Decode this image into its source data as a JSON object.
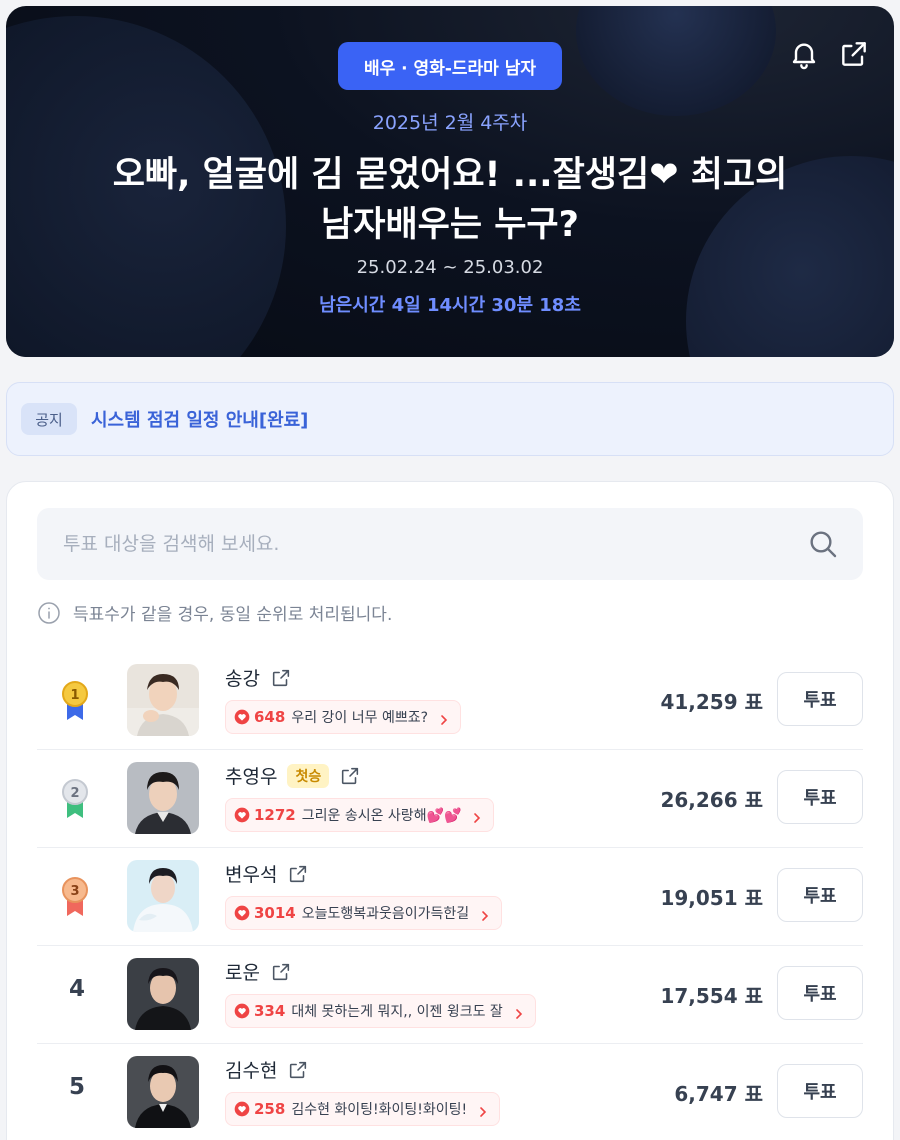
{
  "hero": {
    "category": "배우 · 영화-드라마 남자",
    "week": "2025년 2월 4주차",
    "title_line1": "오빠, 얼굴에 김 묻었어요! ...잘생김",
    "title_heart": "❤",
    "title_line1_end": " 최고의",
    "title_line2": "남자배우는 누구?",
    "period": "25.02.24 ~ 25.03.02",
    "remaining": "남은시간 4일 14시간 30분 18초"
  },
  "notice": {
    "tag": "공지",
    "text": "시스템 점검 일정 안내[완료]"
  },
  "search": {
    "placeholder": "투표 대상을 검색해 보세요."
  },
  "info_text": "득표수가 같을 경우, 동일 순위로 처리됩니다.",
  "vote_label": "투표",
  "entries": [
    {
      "rank": "1",
      "medal": "gold",
      "name": "송강",
      "badge": "",
      "cheer_count": "648",
      "cheer_msg": "우리 강이 너무 예쁘죠?",
      "votes": "41,259 표"
    },
    {
      "rank": "2",
      "medal": "silver",
      "name": "추영우",
      "badge": "첫승",
      "cheer_count": "1272",
      "cheer_msg": "그리운 송시온 사랑해💕💕",
      "votes": "26,266 표"
    },
    {
      "rank": "3",
      "medal": "bronze",
      "name": "변우석",
      "badge": "",
      "cheer_count": "3014",
      "cheer_msg": "오늘도행복과웃음이가득한길",
      "votes": "19,051 표"
    },
    {
      "rank": "4",
      "medal": "",
      "name": "로운",
      "badge": "",
      "cheer_count": "334",
      "cheer_msg": "대체 못하는게 뭐지,, 이젠 윙크도 잘",
      "votes": "17,554 표"
    },
    {
      "rank": "5",
      "medal": "",
      "name": "김수현",
      "badge": "",
      "cheer_count": "258",
      "cheer_msg": "김수현 화이팅!화이팅!화이팅!",
      "votes": "6,747 표"
    }
  ],
  "colors": {
    "accent": "#3a63f5",
    "cheer_red": "#ef4444",
    "hero_bg": "#0c1220"
  },
  "icons": [
    "bell-icon",
    "share-icon",
    "search-icon",
    "info-icon",
    "external-link-icon",
    "heart-icon",
    "chevron-right-icon",
    "medal-icon"
  ]
}
